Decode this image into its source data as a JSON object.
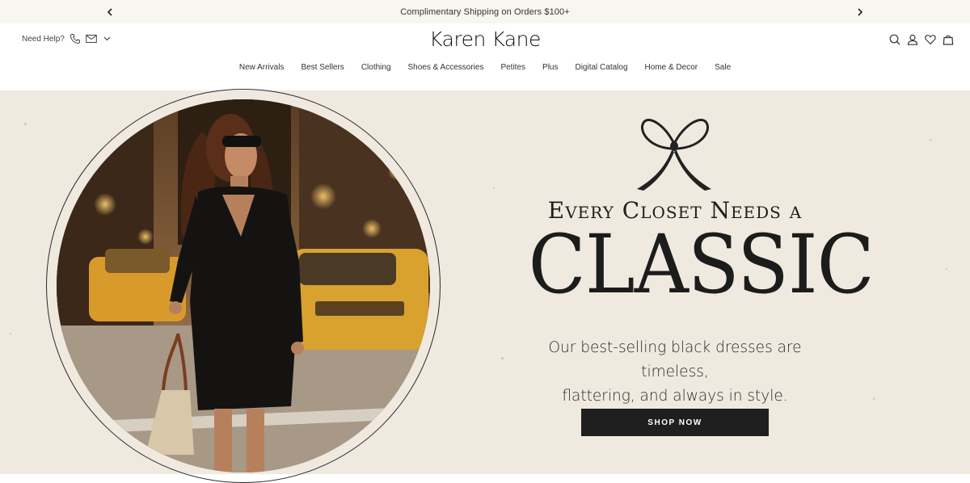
{
  "promo": {
    "message": "Complimentary Shipping on Orders $100+",
    "prev_icon": "chevron-left-icon",
    "next_icon": "chevron-right-icon"
  },
  "header": {
    "need_help_label": "Need Help?",
    "logo_text": "Karen Kane",
    "icons": [
      "phone-icon",
      "mail-icon",
      "chevron-down-icon",
      "search-icon",
      "account-icon",
      "wishlist-heart-icon",
      "bag-icon"
    ]
  },
  "nav": {
    "items": [
      "New Arrivals",
      "Best Sellers",
      "Clothing",
      "Shoes & Accessories",
      "Petites",
      "Plus",
      "Digital Catalog",
      "Home & Decor",
      "Sale"
    ]
  },
  "hero": {
    "headline_line1": "Every Closet Needs a",
    "headline_line2": "CLASSIC",
    "subtext_line1": "Our best-selling black dresses are timeless,",
    "subtext_line2": "flattering, and always in style.",
    "cta_label": "SHOP NOW",
    "colors": {
      "background": "#efe9df",
      "button": "#1f1f1f",
      "text": "#1e1e1e"
    }
  }
}
